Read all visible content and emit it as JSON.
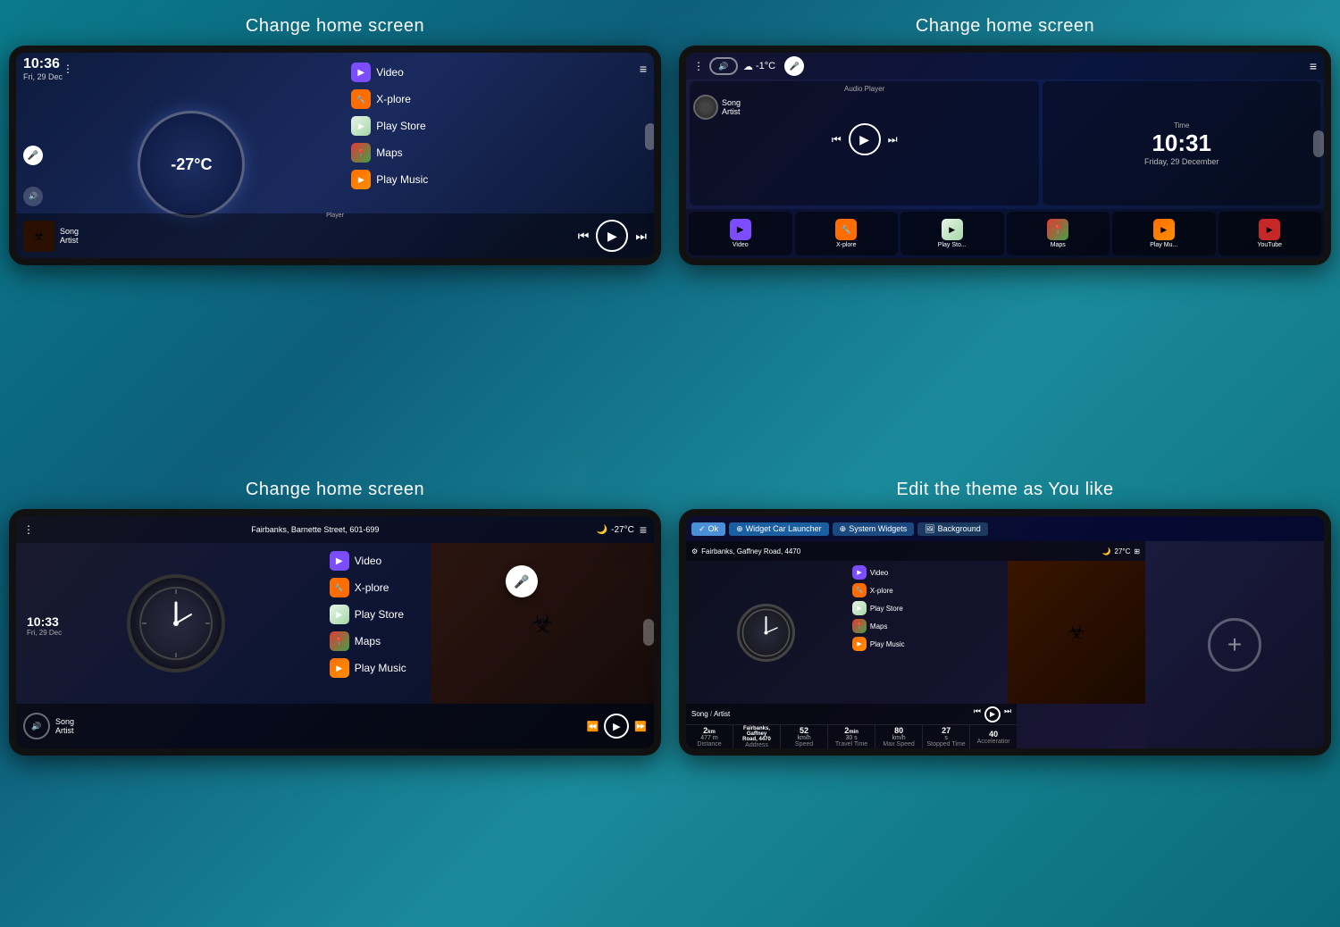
{
  "backgrounds": {
    "main_color": "#0a7a8a"
  },
  "cell1": {
    "title": "Change home screen",
    "screen": {
      "time": "10:36",
      "date": "Fri, 29 Dec",
      "temperature": "-27°C",
      "menu_items": [
        {
          "label": "Video",
          "icon": "purple"
        },
        {
          "label": "X-plore",
          "icon": "orange"
        },
        {
          "label": "Play Store",
          "icon": "blue"
        },
        {
          "label": "Maps",
          "icon": "green"
        },
        {
          "label": "Play Music",
          "icon": "orange2"
        }
      ],
      "player_label": "Player",
      "song": "Song",
      "artist": "Artist"
    }
  },
  "cell2": {
    "title": "Change home screen",
    "screen": {
      "temperature": "-1°C",
      "audio_player_label": "Audio Player",
      "time_label": "Time",
      "song": "Song",
      "artist": "Artist",
      "clock_time": "10:31",
      "clock_date": "Friday, 29 December",
      "bottom_apps": [
        "Video",
        "X-plore",
        "Play Sto...",
        "Maps",
        "Play Mu...",
        "YouTube"
      ]
    }
  },
  "cell3": {
    "title": "Change home screen",
    "screen": {
      "address": "Fairbanks, Barnette Street, 601-699",
      "temperature": "-27°C",
      "clock_time": "10:33",
      "clock_date": "Fri, 29 Dec",
      "menu_items": [
        {
          "label": "Video"
        },
        {
          "label": "X-plore"
        },
        {
          "label": "Play Store"
        },
        {
          "label": "Maps"
        },
        {
          "label": "Play Music"
        }
      ],
      "song": "Song",
      "artist": "Artist"
    }
  },
  "cell4": {
    "title": "Edit the theme as You like",
    "screen": {
      "ok_label": "Ok",
      "widget_label": "Widget Car Launcher",
      "system_label": "System Widgets",
      "background_label": "Background",
      "address": "Fairbanks, Gaffney Road, 4470",
      "temperature": "27°C",
      "menu_items": [
        "Video",
        "X-plore",
        "Play Store",
        "Maps",
        "Play Music"
      ],
      "song": "Song",
      "artist": "Artist",
      "stats": [
        {
          "value": "2",
          "unit": "km",
          "sub": "477 m",
          "label": "Distance"
        },
        {
          "value": "Fairbanks,",
          "unit": "Gaffney",
          "sub": "Road, 4470",
          "label": "Address"
        },
        {
          "value": "52",
          "unit": "km/h",
          "sub": "",
          "label": "Speed"
        },
        {
          "value": "2",
          "unit": "min",
          "sub": "30 s",
          "label": "Travel Time"
        },
        {
          "value": "80",
          "unit": "km/h",
          "sub": "",
          "label": "Max Speed"
        },
        {
          "value": "27",
          "unit": "s",
          "sub": "",
          "label": "Stopped Time"
        },
        {
          "value": "40",
          "unit": "",
          "sub": "",
          "label": "Acceleration"
        }
      ]
    }
  }
}
